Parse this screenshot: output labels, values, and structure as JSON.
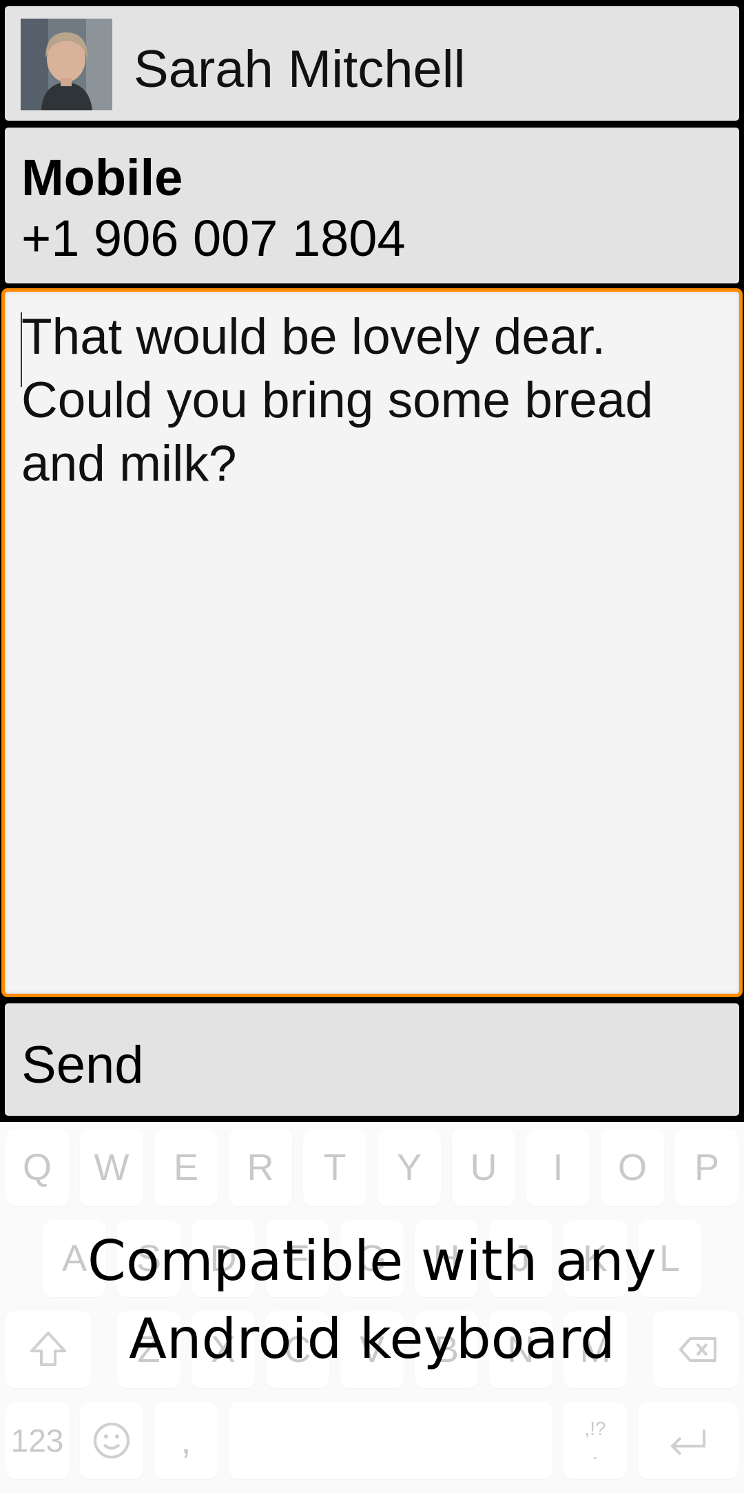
{
  "contact": {
    "name": "Sarah Mitchell",
    "avatar_icon": "contact-photo"
  },
  "number": {
    "type": "Mobile",
    "value": "+1 906 007 1804"
  },
  "message": {
    "text": "That would be lovely dear.\nCould you bring some bread and milk?"
  },
  "send": {
    "label": "Send"
  },
  "keyboard": {
    "row1": [
      "Q",
      "W",
      "E",
      "R",
      "T",
      "Y",
      "U",
      "I",
      "O",
      "P"
    ],
    "row2": [
      "A",
      "S",
      "D",
      "F",
      "G",
      "H",
      "J",
      "K",
      "L"
    ],
    "row3": [
      "Z",
      "X",
      "C",
      "V",
      "B",
      "N",
      "M"
    ],
    "numbers_key": "123",
    "comma_key": ",",
    "punct_top": ",!?",
    "punct_bottom": ".",
    "icons": [
      "shift-icon",
      "backspace-icon",
      "emoji-icon",
      "enter-icon"
    ]
  },
  "overlay": {
    "line1": "Compatible with any",
    "line2": "Android keyboard"
  },
  "colors": {
    "focus_border": "#ff8a00",
    "panel": "#e3e3e3",
    "message_bg": "#f4f4f4"
  }
}
